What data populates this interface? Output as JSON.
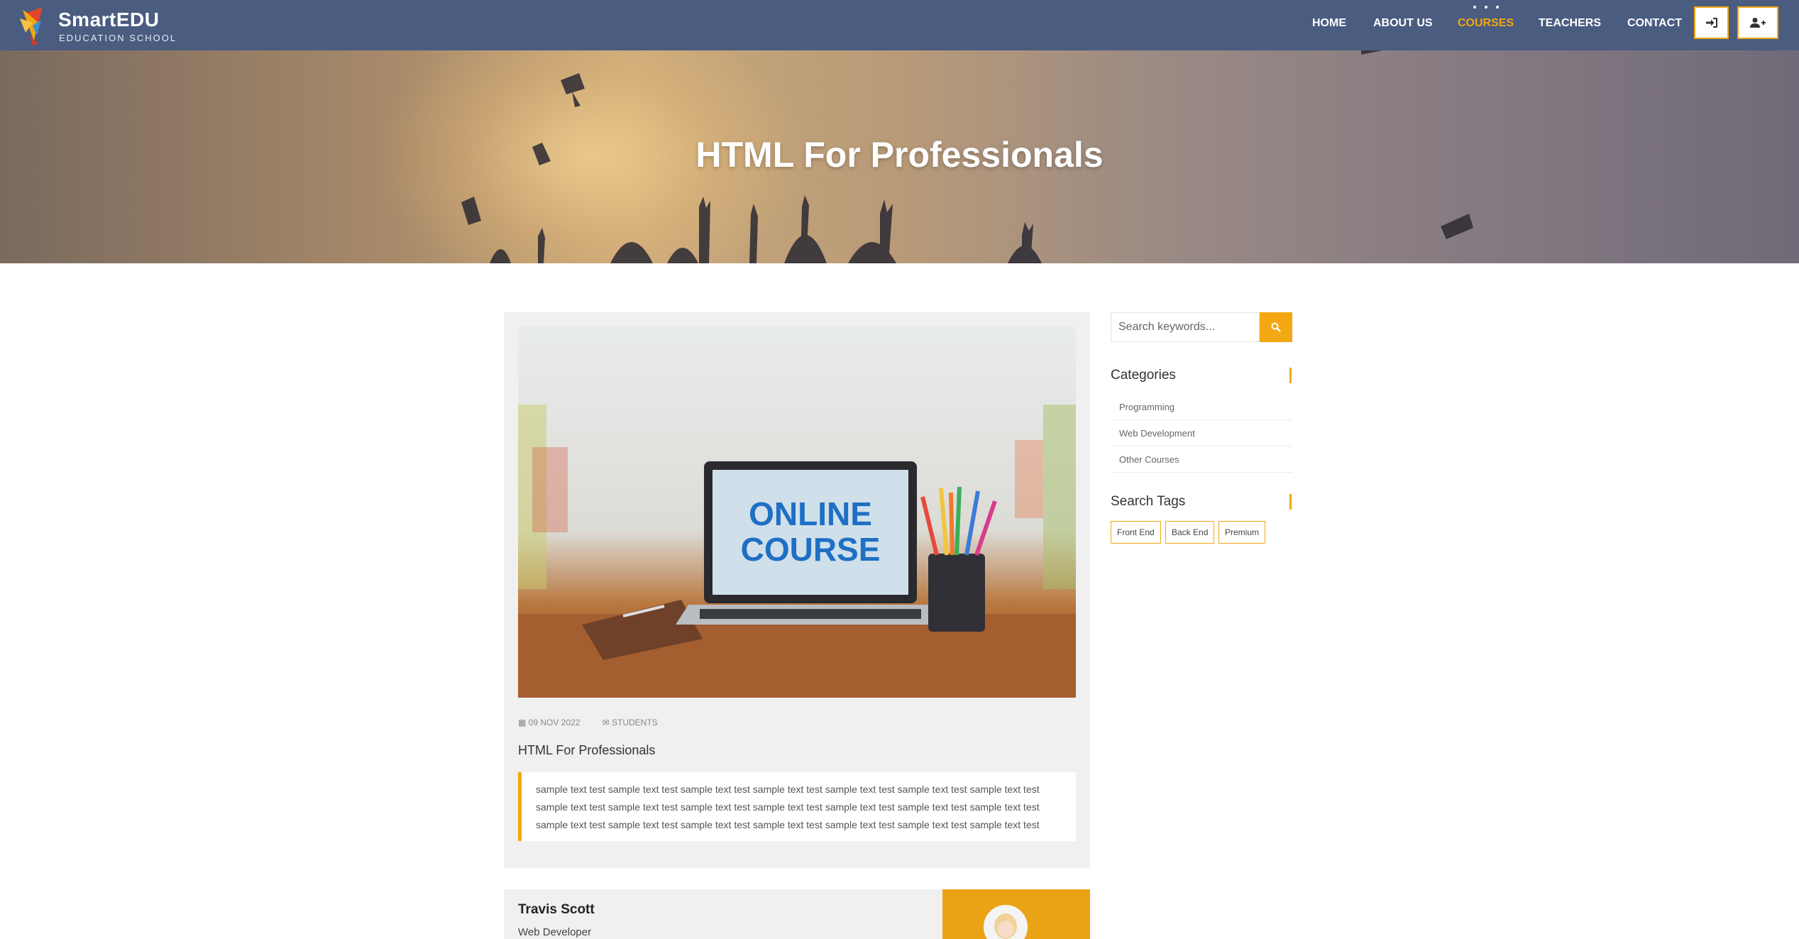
{
  "colors": {
    "navbar": "#4a5c80",
    "accent": "#f3a712",
    "card": "#f0f0f0"
  },
  "brand": {
    "name": "SmartEDU",
    "tagline": "EDUCATION SCHOOL",
    "logo_icon": "bird-logo-icon"
  },
  "nav": {
    "items": [
      {
        "label": "HOME",
        "active": false
      },
      {
        "label": "ABOUT US",
        "active": false
      },
      {
        "label": "COURSES",
        "active": true
      },
      {
        "label": "TEACHERS",
        "active": false
      },
      {
        "label": "CONTACT",
        "active": false
      }
    ],
    "login_icon": "sign-in-icon",
    "register_icon": "user-plus-icon"
  },
  "hero": {
    "title": "HTML For Professionals"
  },
  "post": {
    "image_text": [
      "ONLINE",
      "COURSE"
    ],
    "date": "09 NOV 2022",
    "category": "STUDENTS",
    "title": "HTML For Professionals",
    "body": "sample text test sample text test sample text test sample text test sample text test sample text test sample text test sample text test sample text test sample text test sample text test sample text test sample text test sample text test sample text test sample text test sample text test sample text test sample text test sample text test sample text test"
  },
  "author": {
    "name": "Travis Scott",
    "role": "Web Developer"
  },
  "sidebar": {
    "search": {
      "placeholder": "Search keywords..."
    },
    "categories_title": "Categories",
    "categories": [
      "Programming",
      "Web Development",
      "Other Courses"
    ],
    "tags_title": "Search Tags",
    "tags": [
      "Front End",
      "Back End",
      "Premium"
    ]
  }
}
